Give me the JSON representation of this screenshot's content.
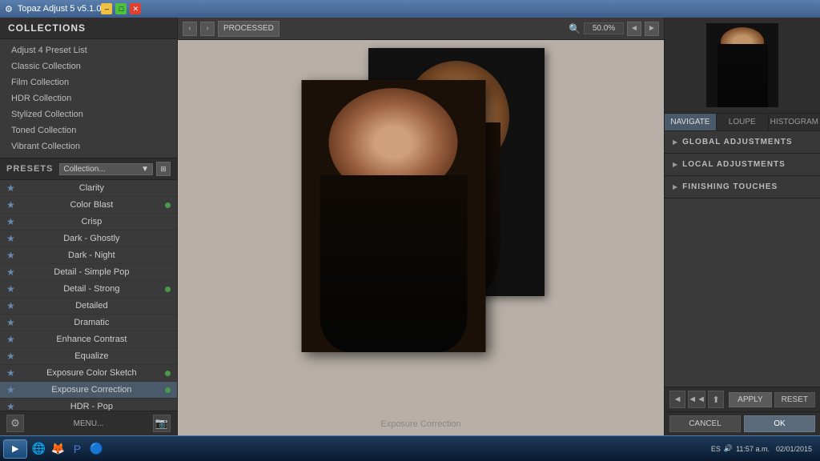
{
  "titlebar": {
    "title": "Topaz Adjust 5 v5.1.0",
    "icon": "⚙"
  },
  "left": {
    "collections_header": "COLLECTIONS",
    "collections": [
      {
        "label": "Adjust 4 Preset List"
      },
      {
        "label": "Classic Collection"
      },
      {
        "label": "Film Collection"
      },
      {
        "label": "HDR Collection"
      },
      {
        "label": "Stylized Collection"
      },
      {
        "label": "Toned Collection"
      },
      {
        "label": "Vibrant Collection"
      }
    ],
    "presets_label": "PRESETS",
    "collection_selector": "Collection...",
    "presets": [
      {
        "name": "Clarity",
        "starred": true,
        "dot": false
      },
      {
        "name": "Color Blast",
        "starred": true,
        "dot": true
      },
      {
        "name": "Crisp",
        "starred": true,
        "dot": false
      },
      {
        "name": "Dark - Ghostly",
        "starred": true,
        "dot": false
      },
      {
        "name": "Dark - Night",
        "starred": true,
        "dot": false
      },
      {
        "name": "Detail - Simple Pop",
        "starred": true,
        "dot": false
      },
      {
        "name": "Detail - Strong",
        "starred": true,
        "dot": true
      },
      {
        "name": "Detailed",
        "starred": true,
        "dot": false
      },
      {
        "name": "Dramatic",
        "starred": true,
        "dot": false
      },
      {
        "name": "Enhance Contrast",
        "starred": true,
        "dot": false
      },
      {
        "name": "Equalize",
        "starred": true,
        "dot": false
      },
      {
        "name": "Exposure Color Sketch",
        "starred": true,
        "dot": true
      },
      {
        "name": "Exposure Correction",
        "starred": true,
        "dot": true,
        "active": true
      },
      {
        "name": "HDR - Pop",
        "starred": true,
        "dot": false
      }
    ],
    "menu_label": "MENU..."
  },
  "toolbar": {
    "nav_left": "‹",
    "nav_right": "›",
    "processed_label": "PROCESSED",
    "zoom_icon": "🔍",
    "zoom_value": "50.0%",
    "nav_prev": "◄",
    "nav_next": "►"
  },
  "canvas": {
    "caption": "Exposure Correction"
  },
  "right": {
    "tabs": [
      {
        "label": "NAVIGATE",
        "active": true
      },
      {
        "label": "LOUPE",
        "active": false
      },
      {
        "label": "HISTOGRAM",
        "active": false
      }
    ],
    "adjustments": [
      {
        "label": "GLOBAL ADJUSTMENTS"
      },
      {
        "label": "LOCAL ADJUSTMENTS"
      },
      {
        "label": "FINISHING TOUCHES"
      }
    ],
    "apply_label": "APPLY",
    "reset_label": "RESET",
    "cancel_label": "CANCEL",
    "ok_label": "OK"
  },
  "taskbar": {
    "start_label": "▶",
    "items": [],
    "tray": {
      "lang": "ES",
      "time": "11:57 a.m.",
      "date": "02/01/2015"
    }
  }
}
